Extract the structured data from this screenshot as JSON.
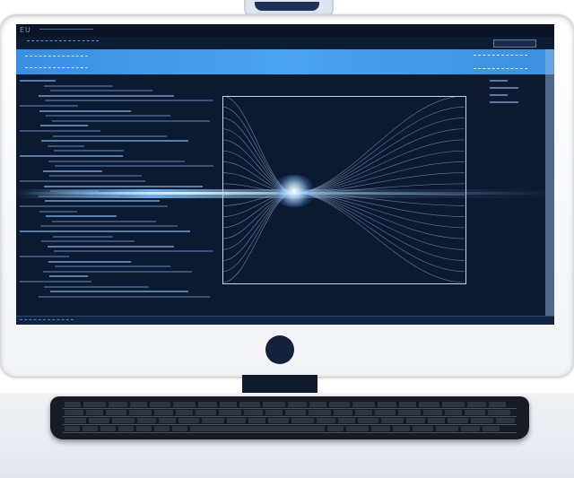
{
  "screen": {
    "title": "EU",
    "accent_color": "#4aa3ef",
    "background_color": "#0c1a31"
  },
  "icons": {
    "power": "power-button-icon"
  }
}
